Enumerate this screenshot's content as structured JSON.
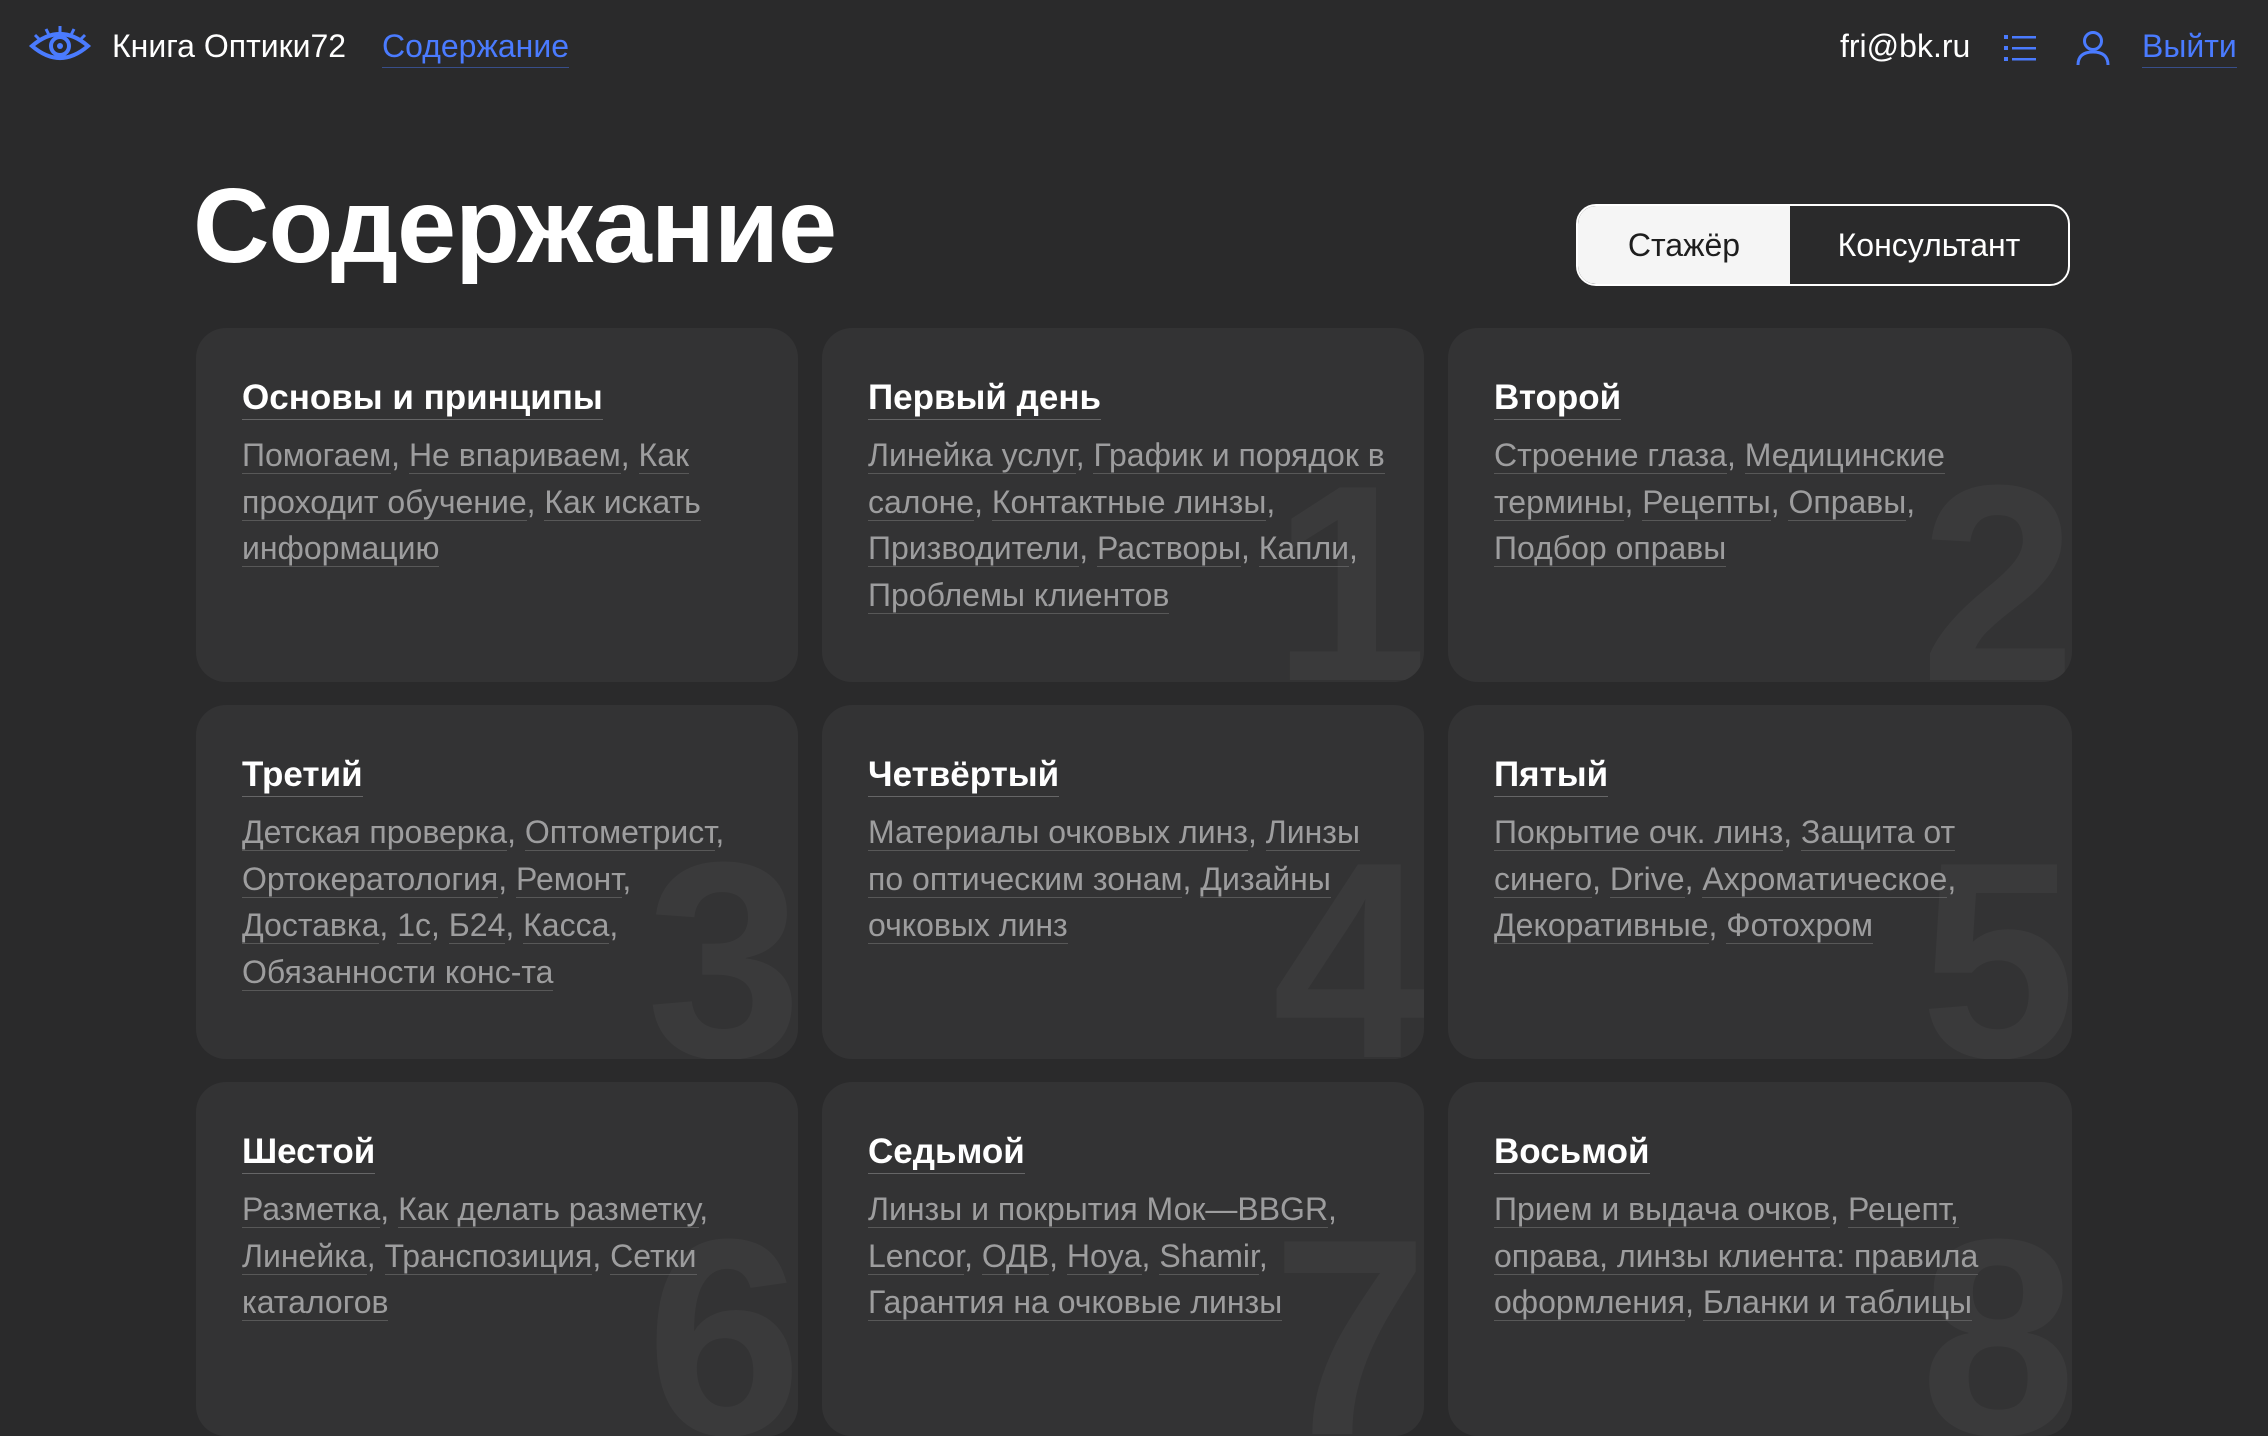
{
  "header": {
    "brand": "Книга Оптики72",
    "nav_link": "Содержание",
    "email": "fri@bk.ru",
    "logout": "Выйти",
    "icons": [
      "eye-logo-icon",
      "list-icon",
      "user-icon"
    ],
    "accent_color": "#4a7bff"
  },
  "page": {
    "title": "Содержание",
    "toggle": {
      "options": [
        "Стажёр",
        "Консультант"
      ],
      "selected": "Стажёр"
    }
  },
  "cards": [
    {
      "number": "",
      "title": "Основы и принципы",
      "links": [
        "Помогаем",
        "Не впариваем",
        "Как проходит обучение",
        "Как искать информацию"
      ]
    },
    {
      "number": "1",
      "title": "Первый день",
      "links": [
        "Линейка услуг",
        "График и порядок в салоне",
        "Контактные линзы",
        "Призводители",
        "Растворы",
        "Капли",
        "Проблемы клиентов"
      ]
    },
    {
      "number": "2",
      "title": "Второй",
      "links": [
        "Строение глаза",
        "Медицинские термины",
        "Рецепты",
        "Оправы",
        "Подбор оправы"
      ]
    },
    {
      "number": "3",
      "title": "Третий",
      "links": [
        "Детская проверка",
        "Оптометрист",
        "Ортокератология",
        "Ремонт",
        "Доставка",
        "1с",
        "Б24",
        "Касса",
        "Обязанности конс-та"
      ]
    },
    {
      "number": "4",
      "title": "Четвёртый",
      "links": [
        "Материалы очковых линз",
        "Линзы по оптическим зонам",
        "Дизайны очковых линз"
      ]
    },
    {
      "number": "5",
      "title": "Пятый",
      "links": [
        "Покрытие очк. линз",
        "Защита от синего",
        "Drive",
        "Ахроматическое",
        "Декоративные",
        "Фотохром"
      ]
    },
    {
      "number": "6",
      "title": "Шестой",
      "links": [
        "Разметка",
        "Как делать разметку",
        "Линейка",
        "Транспозиция",
        "Сетки каталогов"
      ]
    },
    {
      "number": "7",
      "title": "Седьмой",
      "links": [
        "Линзы и покрытия Мок—BBGR",
        "Lencor",
        "ОДВ",
        "Hoya",
        "Shamir",
        "Гарантия на очковые линзы"
      ]
    },
    {
      "number": "8",
      "title": "Восьмой",
      "links": [
        "Прием и выдача очков",
        "Рецепт, оправа, линзы клиента: правила оформления",
        "Бланки и таблицы"
      ]
    }
  ]
}
